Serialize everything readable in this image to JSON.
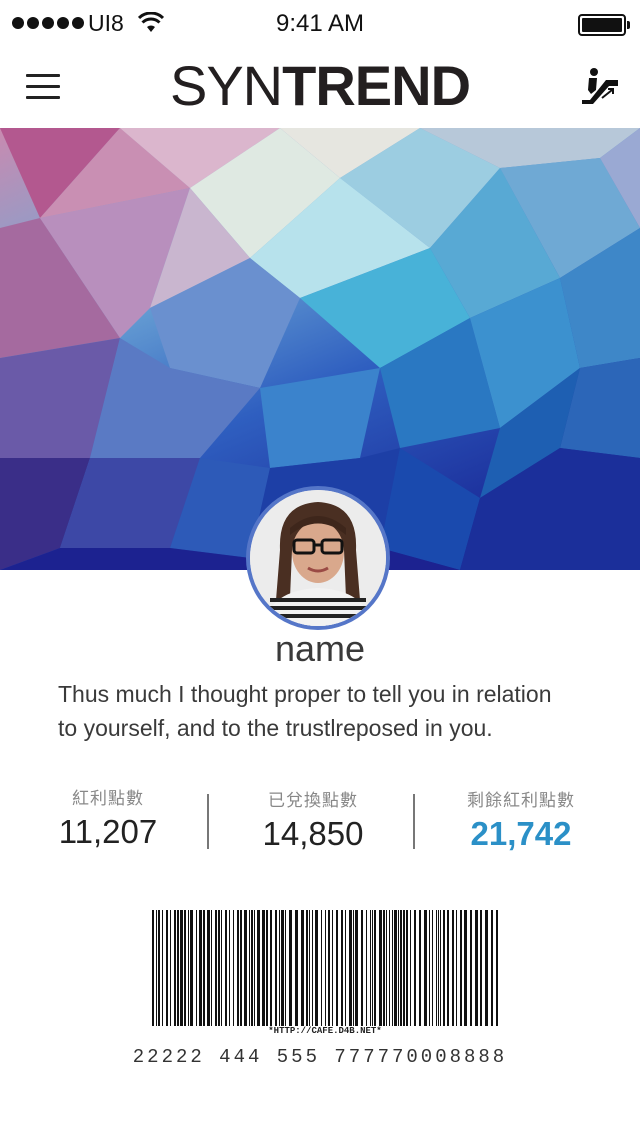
{
  "status_bar": {
    "carrier": "UI8",
    "time": "9:41 AM"
  },
  "header": {
    "logo_light": "SYN",
    "logo_bold": "TREND"
  },
  "profile": {
    "name": "name",
    "bio_line1": "Thus much I thought proper to tell you in relation",
    "bio_line2": "to yourself, and to the trustlreposed in you."
  },
  "stats": [
    {
      "label": "紅利點數",
      "value": "11,207"
    },
    {
      "label": "已兌換點數",
      "value": "14,850"
    },
    {
      "label": "剩餘紅利點數",
      "value": "21,742"
    }
  ],
  "barcode": {
    "caption": "*HTTP://CAFE.D4B.NET*",
    "number": "22222 444 555 777770008888"
  },
  "colors": {
    "accent": "#2b90c7",
    "avatar_ring": "#5576c8"
  }
}
